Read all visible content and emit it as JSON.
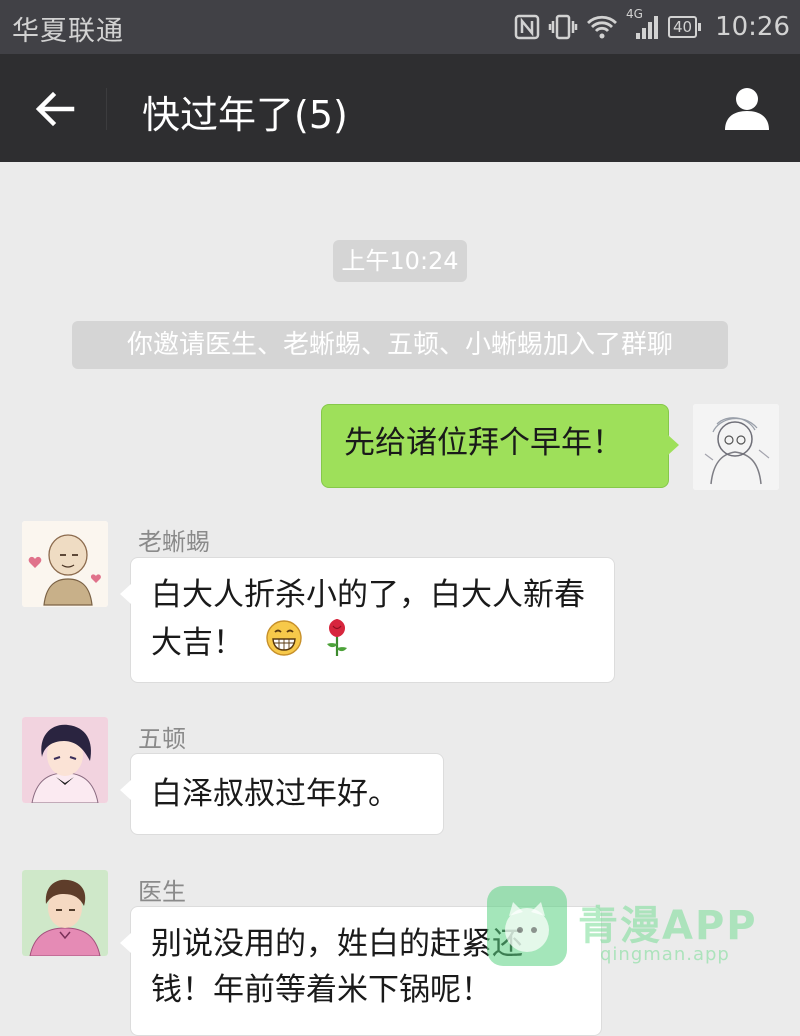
{
  "status_bar": {
    "carrier": "华夏联通",
    "network": "4G",
    "battery": "40",
    "time": "10:26"
  },
  "header": {
    "title": "快过年了(5)",
    "back_icon": "arrow-left-icon",
    "members_icon": "person-icon"
  },
  "chat": {
    "timestamp": "上午10:24",
    "system_message": "你邀请医生、老蜥蜴、五顿、小蜥蜴加入了群聊",
    "messages": [
      {
        "side": "right",
        "sender": "",
        "text": "先给诸位拜个早年！"
      },
      {
        "side": "left",
        "sender": "老蜥蜴",
        "text": "白大人折杀小的了，白大人新春大吉！",
        "emoji": [
          "grin-icon",
          "rose-icon"
        ]
      },
      {
        "side": "left",
        "sender": "五顿",
        "text": "白泽叔叔过年好。"
      },
      {
        "side": "left",
        "sender": "医生",
        "text": "别说没用的，姓白的赶紧还钱！年前等着米下锅呢！"
      }
    ]
  },
  "watermark": {
    "name": "青漫APP",
    "domain": "qingman.app"
  },
  "colors": {
    "status_bar": "#414146",
    "title_bar": "#2e2e30",
    "chat_bg": "#ebebeb",
    "bubble_self": "#9ee05a",
    "bubble_other": "#ffffff"
  }
}
